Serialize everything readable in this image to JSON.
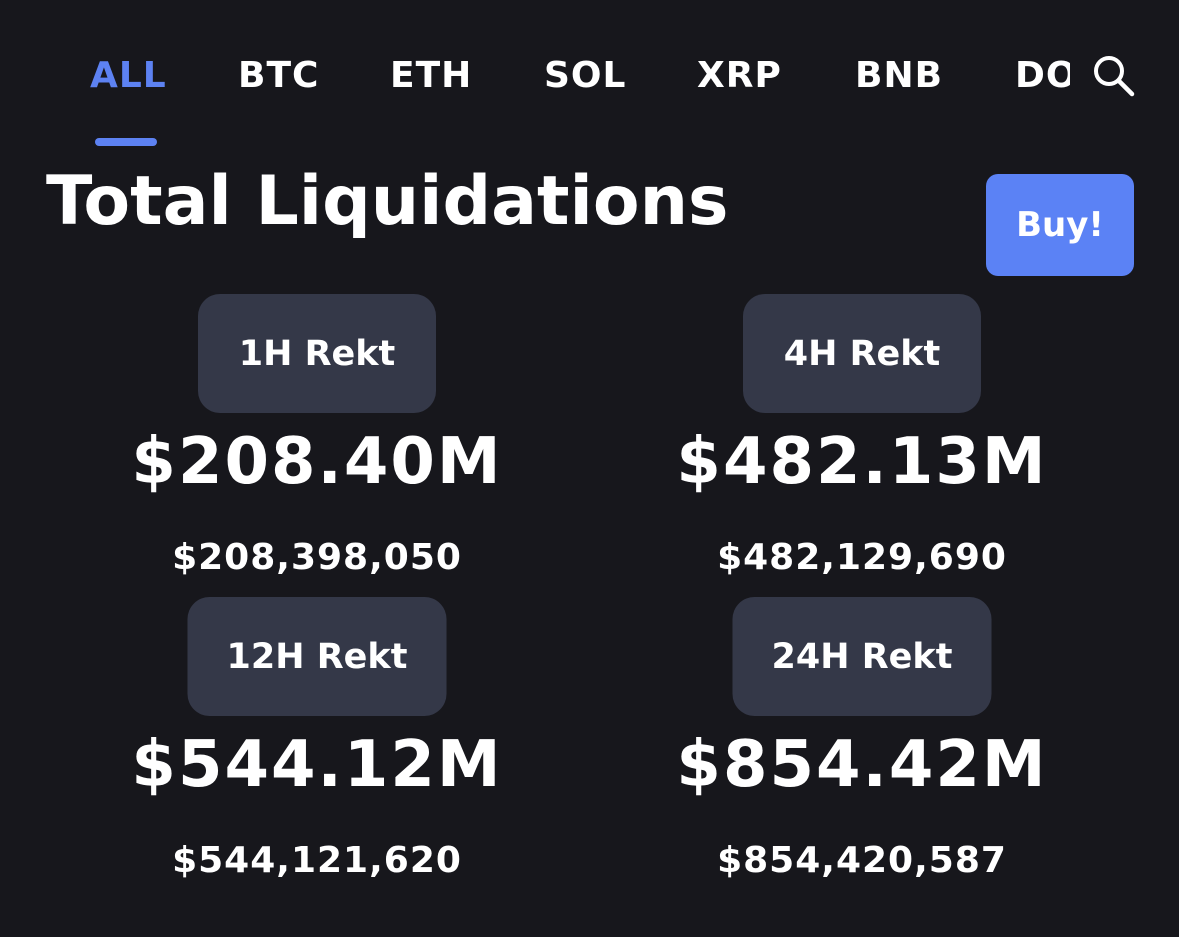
{
  "tabs": {
    "items": [
      {
        "label": "ALL",
        "active": true
      },
      {
        "label": "BTC",
        "active": false
      },
      {
        "label": "ETH",
        "active": false
      },
      {
        "label": "SOL",
        "active": false
      },
      {
        "label": "XRP",
        "active": false
      },
      {
        "label": "BNB",
        "active": false
      },
      {
        "label": "DOGE",
        "active": false
      }
    ],
    "search_icon": "search-icon"
  },
  "title": "Total Liquidations",
  "buy_button": "Buy!",
  "colors": {
    "background": "#17171c",
    "accent": "#5d82f2",
    "pill": "#343848",
    "text": "#ffffff"
  },
  "stats": [
    {
      "label": "1H Rekt",
      "amount": "$208.40M",
      "exact": "$208,398,050"
    },
    {
      "label": "4H Rekt",
      "amount": "$482.13M",
      "exact": "$482,129,690"
    },
    {
      "label": "12H Rekt",
      "amount": "$544.12M",
      "exact": "$544,121,620"
    },
    {
      "label": "24H Rekt",
      "amount": "$854.42M",
      "exact": "$854,420,587"
    }
  ]
}
